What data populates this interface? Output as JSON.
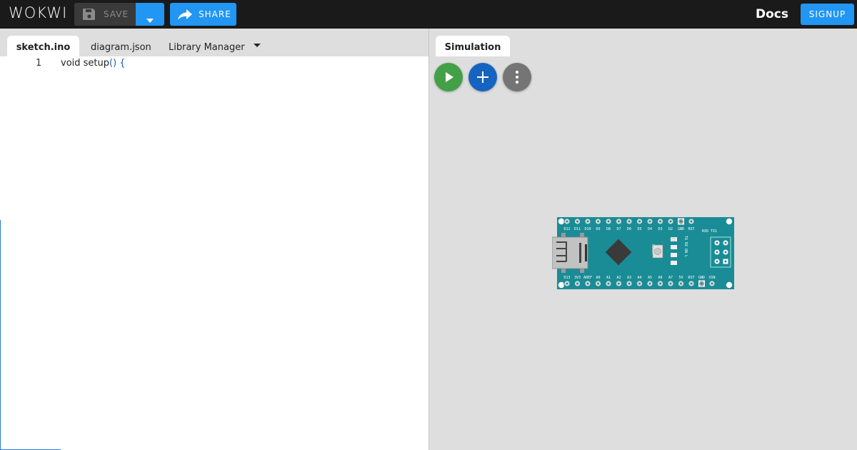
{
  "header": {
    "logo": "WOKWI",
    "save_label": "SAVE",
    "share_label": "SHARE",
    "docs_label": "Docs",
    "signup_label": "SIGNUP"
  },
  "editor": {
    "tabs": [
      {
        "label": "sketch.ino",
        "active": true
      },
      {
        "label": "diagram.json",
        "active": false
      },
      {
        "label": "Library Manager",
        "active": false
      }
    ],
    "lines": [
      {
        "number": "1",
        "text": "void setup",
        "punct": "() {"
      }
    ]
  },
  "simulation": {
    "tab_label": "Simulation",
    "board": {
      "top_pins": [
        "D12",
        "D11",
        "D10",
        "D9",
        "D8",
        "D7",
        "D6",
        "D5",
        "D4",
        "D3",
        "D2",
        "GND",
        "RST"
      ],
      "bottom_pins": [
        "D13",
        "3V3",
        "AREF",
        "A0",
        "A1",
        "A2",
        "A3",
        "A4",
        "A5",
        "A6",
        "A7",
        "5V",
        "RST",
        "GND",
        "VIN"
      ],
      "serial_label": "RX0 TX1",
      "reset_label": "RESET",
      "led_labels": "TX RX ON L",
      "color": "#1a8c96"
    }
  },
  "colors": {
    "accent": "#2196f3",
    "play": "#43a047",
    "add": "#1565c0",
    "more": "#757575"
  },
  "icons": [
    "save-icon",
    "chevron-down-icon",
    "share-icon",
    "play-icon",
    "add-icon",
    "more-vert-icon"
  ]
}
